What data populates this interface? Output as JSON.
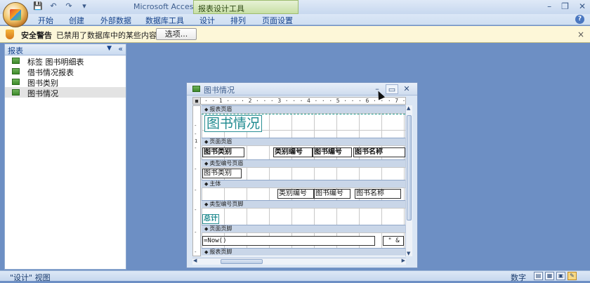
{
  "window": {
    "app_title": "Microsoft Access",
    "context_tab_group": "报表设计工具",
    "quick_access": [
      "save",
      "undo",
      "redo",
      "customize"
    ],
    "controls": [
      "minimize",
      "restore",
      "close"
    ]
  },
  "ribbon": {
    "tabs": [
      "开始",
      "创建",
      "外部数据",
      "数据库工具",
      "设计",
      "排列",
      "页面设置"
    ],
    "help": "?"
  },
  "message_bar": {
    "title": "安全警告",
    "text": "已禁用了数据库中的某些内容",
    "button": "选项...",
    "close": "×"
  },
  "nav_pane": {
    "header": "报表",
    "items": [
      {
        "label": "标签 图书明细表",
        "selected": false
      },
      {
        "label": "借书情况报表",
        "selected": false
      },
      {
        "label": "图书类别",
        "selected": false
      },
      {
        "label": "图书情况",
        "selected": true
      }
    ]
  },
  "report_window": {
    "title": "图书情况",
    "ruler_text": "· · 1 · · · 2 · · · 3 · · · 4 · · · 5 · · · 6 · · · 7 · · · 8 · · · 9",
    "vruler_marks": [
      "-",
      "-",
      "1",
      "-",
      "-",
      "-",
      "-",
      "-",
      "-",
      "-",
      "-",
      "-",
      "-",
      "-"
    ],
    "sections": {
      "report_header": "报表页眉",
      "page_header": "页面页眉",
      "group_header": "类型编号页眉",
      "detail": "主体",
      "group_footer": "类型编号页脚",
      "page_footer": "页面页脚",
      "report_footer": "报表页脚"
    },
    "report_title": "图书情况",
    "page_header_labels": [
      "图书类别",
      "类别编号",
      "图书编号",
      "图书名称"
    ],
    "group_header_field": "图书类别",
    "detail_fields": [
      "类别编号",
      "图书编号",
      "图书名称"
    ],
    "group_footer_label": "总计",
    "page_footer_left": "=Now()",
    "page_footer_right": "\" &"
  },
  "status_bar": {
    "left": "\"设计\" 视图",
    "right": "数字"
  }
}
